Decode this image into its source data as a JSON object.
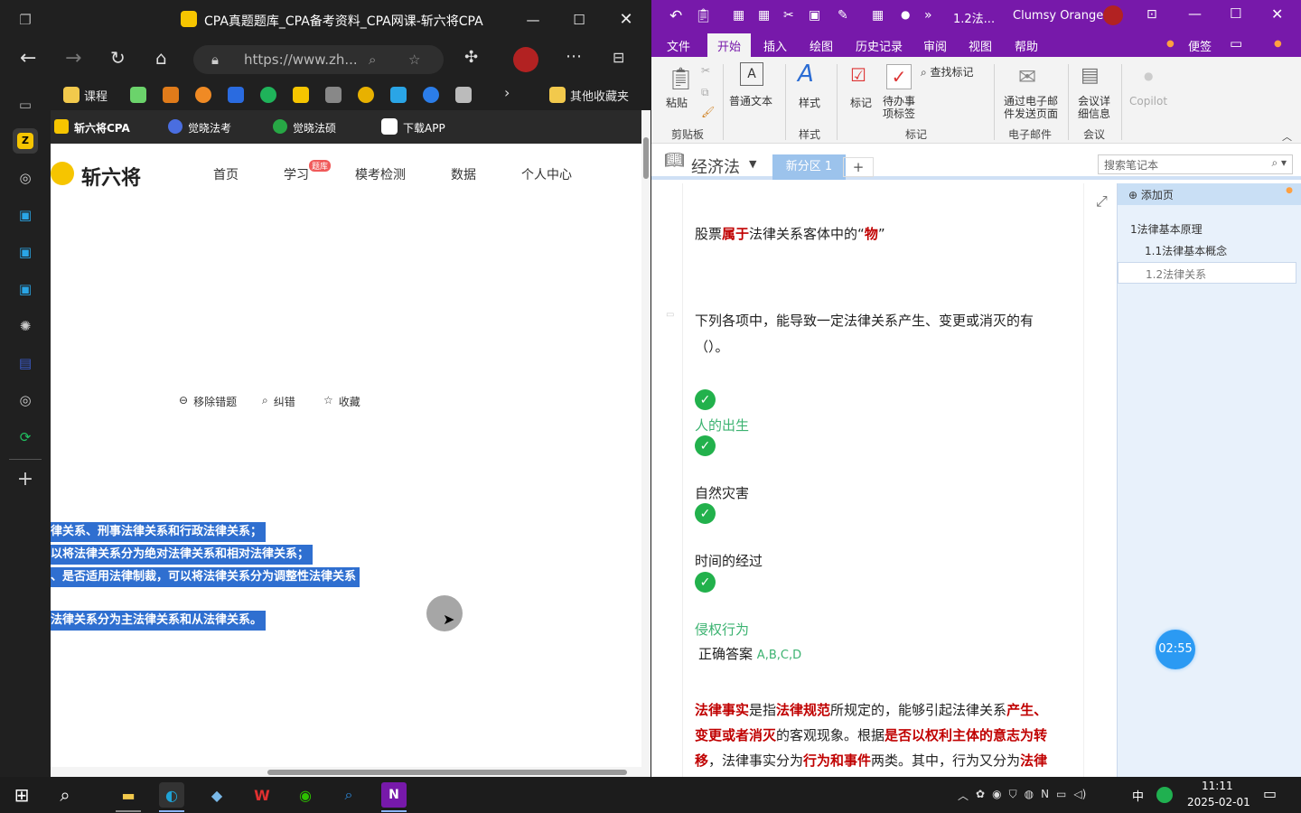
{
  "browser": {
    "tab_title": "CPA真题题库_CPA备考资料_CPA网课-斩六将CPA",
    "url": "https://www.zh...",
    "favorites": [
      "课程",
      "其他收藏夹"
    ],
    "site_links": [
      "斩六将CPA",
      "觉晓法考",
      "觉晓法硕",
      "下载APP"
    ],
    "logo_text": "斩六将",
    "nav": [
      "首页",
      "学习",
      "模考检测",
      "数据",
      "个人中心"
    ],
    "nav_badge": "题库",
    "actions": [
      "移除错题",
      "纠错",
      "收藏"
    ],
    "selected_lines": [
      "律关系、刑事法律关系和行政法律关系；",
      "以将法律关系分为绝对法律关系和相对法律关系；",
      "、是否适用法律制裁，可以将法律关系分为调整性法律关系",
      "法律关系分为主法律关系和从法律关系。"
    ]
  },
  "onenote": {
    "title": "1.2法...",
    "user": "Clumsy Orange",
    "tabs": [
      "文件",
      "开始",
      "插入",
      "绘图",
      "历史记录",
      "审阅",
      "视图",
      "帮助"
    ],
    "active_tab": "开始",
    "sticky": "便签",
    "ribbon": {
      "paste": "粘贴",
      "clipboard": "剪贴板",
      "normal_text": "普通文本",
      "style_btn": "样式",
      "style_group": "样式",
      "tag": "标记",
      "todo": "待办事项标签",
      "find_tag": "查找标记",
      "tag_group": "标记",
      "email": "通过电子邮件发送页面",
      "email_group": "电子邮件",
      "meeting": "会议详细信息",
      "meeting_group": "会议",
      "copilot": "Copilot"
    },
    "notebook": "经济法",
    "section": "新分区 1",
    "search_placeholder": "搜索笔记本",
    "add_page": "添加页",
    "pages": [
      "1法律基本原理",
      "1.1法律基本概念",
      "1.2法律关系"
    ],
    "timer": "02:55",
    "content": {
      "stock_line_1": "股票",
      "stock_line_2": "属于",
      "stock_line_3": "法律关系客体中的“",
      "stock_line_4": "物",
      "stock_line_5": "”",
      "question": "下列各项中，能导致一定法律关系产生、变更或消灭的有（）。",
      "options": [
        "人的出生",
        "自然灾害",
        "时间的经过",
        "侵权行为"
      ],
      "answer_label": "正确答案",
      "answer": "A,B,C,D",
      "explain_1a": "法律事实",
      "explain_1b": "是指",
      "explain_1c": "法律规范",
      "explain_1d": "所规定的，能够引起法律关系",
      "explain_1e": "产生、",
      "explain_2a": "变更或者消灭",
      "explain_2b": "的客观现象。根据",
      "explain_2c": "是否以权利主体的意志为转",
      "explain_3a": "移",
      "explain_3b": "，法律事实分为",
      "explain_3c": "行为和事件",
      "explain_3d": "两类。其中，行为又分为",
      "explain_3e": "法律"
    }
  },
  "taskbar": {
    "time": "11:11",
    "date": "2025-02-01",
    "ime": "中"
  },
  "colors": {
    "onenote_purple": "#7719aa",
    "selection_blue": "#2f6fd0",
    "check_green": "#22b14c",
    "answer_green": "#3cb371",
    "red": "#c00000"
  }
}
